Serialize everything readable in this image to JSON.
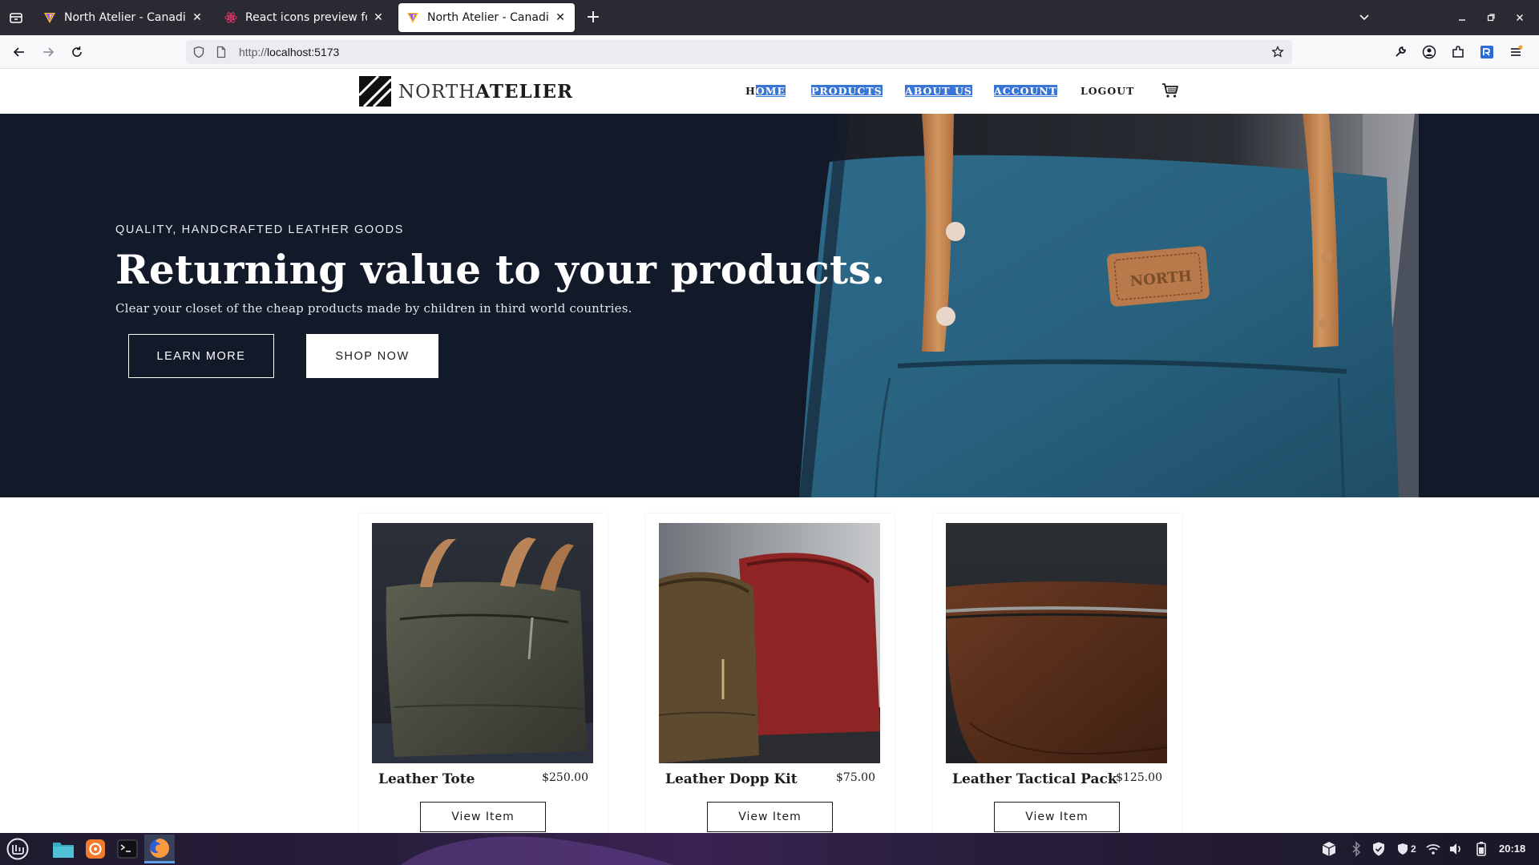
{
  "browser": {
    "tabs": [
      {
        "title": "North Atelier - Canadian Ha",
        "active": false
      },
      {
        "title": "React icons preview for fa",
        "active": false
      },
      {
        "title": "North Atelier - Canadian Ha",
        "active": true
      }
    ],
    "url_scheme": "http://",
    "url_host": "localhost:5173",
    "icons": [
      "tab-list-icon",
      "new-tab-icon",
      "list-all-tabs-icon",
      "minimize-icon",
      "maximize-icon",
      "close-icon",
      "back-icon",
      "forward-icon",
      "reload-icon",
      "shield-icon",
      "page-icon",
      "bookmark-star-icon",
      "wrench-icon",
      "account-icon",
      "extensions-icon",
      "extension-icon",
      "menu-icon"
    ]
  },
  "site": {
    "logo": {
      "light": "NORTH",
      "bold": "ATELIER"
    },
    "nav": {
      "home_first": "H",
      "home_rest": "OME",
      "products": "PRODUCTS",
      "about": "ABOUT US",
      "account": "ACCOUNT",
      "logout": "LOGOUT"
    },
    "cart_icon": "cart-icon"
  },
  "hero": {
    "eyebrow": "QUALITY, HANDCRAFTED LEATHER GOODS",
    "headline": "Returning value to your products.",
    "subline": "Clear your closet of the cheap products made by children in third world countries.",
    "learn_more": "LEARN MORE",
    "shop_now": "SHOP NOW",
    "patch_text": "NORTH"
  },
  "products": [
    {
      "name": "Leather Tote",
      "price": "$250.00",
      "button": "View Item"
    },
    {
      "name": "Leather Dopp Kit",
      "price": "$75.00",
      "button": "View Item"
    },
    {
      "name": "Leather Tactical Pack",
      "price": "$125.00",
      "button": "View Item"
    }
  ],
  "taskbar": {
    "apps": [
      "mint-menu-icon",
      "files-icon",
      "software-icon",
      "terminal-icon",
      "firefox-icon"
    ],
    "tray_count": "2",
    "time": "20:18"
  },
  "colors": {
    "hero_bg": "#121a2a",
    "selection": "#3875d7",
    "bag_blue": "#2f6f8f",
    "strap_tan": "#c98a57"
  }
}
